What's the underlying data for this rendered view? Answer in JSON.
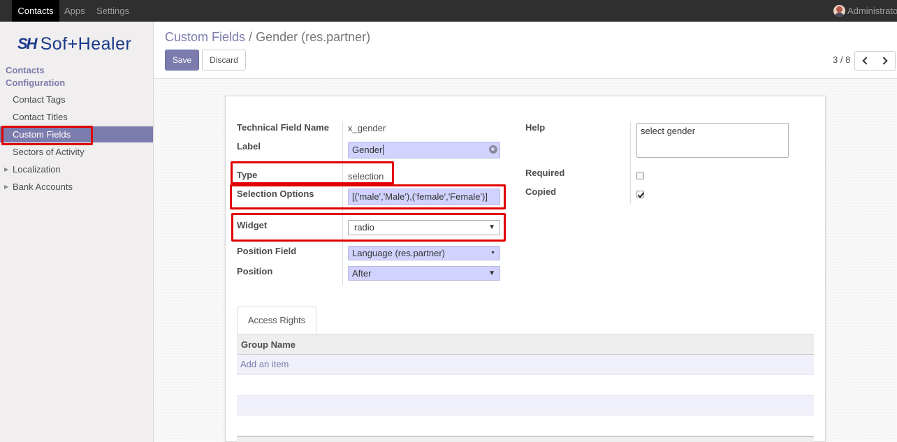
{
  "topbar": {
    "menus": [
      "Contacts",
      "Apps",
      "Settings"
    ],
    "user": "Administrator"
  },
  "sidebar": {
    "logo_mark": "SH",
    "logo_word": "Sof+Healer",
    "section": "Contacts",
    "subsection": "Configuration",
    "items": [
      {
        "label": "Contact Tags"
      },
      {
        "label": "Contact Titles"
      },
      {
        "label": "Custom Fields"
      },
      {
        "label": "Sectors of Activity"
      },
      {
        "label": "Localization"
      },
      {
        "label": "Bank Accounts"
      }
    ]
  },
  "control_panel": {
    "breadcrumb_parent": "Custom Fields",
    "breadcrumb_sep": "/",
    "breadcrumb_current": "Gender (res.partner)",
    "save_label": "Save",
    "discard_label": "Discard",
    "pager": "3 / 8"
  },
  "form": {
    "technical_field_name_label": "Technical Field Name",
    "technical_field_name": "x_gender",
    "label_label": "Label",
    "label_value": "Gender",
    "type_label": "Type",
    "type_value": "selection",
    "selection_options_label": "Selection Options",
    "selection_options_value": "[('male','Male'),('female','Female')]",
    "widget_label": "Widget",
    "widget_value": "radio",
    "position_field_label": "Position Field",
    "position_field_value": "Language (res.partner)",
    "position_label": "Position",
    "position_value": "After",
    "help_label": "Help",
    "help_value": "select gender",
    "required_label": "Required",
    "required": false,
    "copied_label": "Copied",
    "copied": true
  },
  "tabs": {
    "access_rights": "Access Rights",
    "column_group_name": "Group Name",
    "add_item": "Add an item"
  },
  "colors": {
    "accent": "#7c7bad",
    "highlight": "#e00000",
    "input_bg": "#d2d2ff"
  }
}
